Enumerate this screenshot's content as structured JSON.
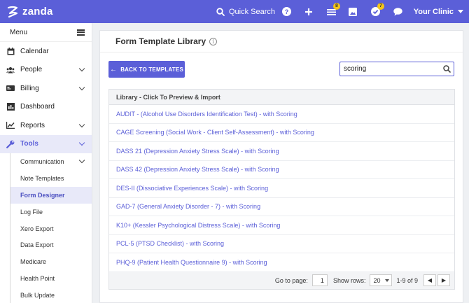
{
  "app": {
    "brand": "zanda",
    "accent": "#5b5fd8"
  },
  "topbar": {
    "quick_search": "Quick Search",
    "help_icon": "help-icon",
    "add_icon": "plus-icon",
    "tasks_badge": "8",
    "checks_badge": "7",
    "clinic_label": "Your Clinic"
  },
  "sidebar": {
    "menu_label": "Menu",
    "items": [
      {
        "label": "Calendar",
        "icon": "calendar-icon"
      },
      {
        "label": "People",
        "icon": "people-icon"
      },
      {
        "label": "Billing",
        "icon": "billing-icon"
      },
      {
        "label": "Dashboard",
        "icon": "dashboard-icon"
      },
      {
        "label": "Reports",
        "icon": "reports-icon"
      },
      {
        "label": "Tools",
        "icon": "wrench-icon"
      }
    ],
    "sub_items": [
      {
        "label": "Communication"
      },
      {
        "label": "Note Templates"
      },
      {
        "label": "Form Designer"
      },
      {
        "label": "Log File"
      },
      {
        "label": "Xero Export"
      },
      {
        "label": "Data Export"
      },
      {
        "label": "Medicare"
      },
      {
        "label": "Health Point"
      },
      {
        "label": "Bulk Update"
      }
    ]
  },
  "main": {
    "title": "Form Template Library",
    "back_button": "BACK TO TEMPLATES",
    "search_value": "scoring",
    "table_header": "Library - Click To Preview & Import",
    "rows": [
      "AUDIT - (Alcohol Use Disorders Identification Test) - with Scoring",
      "CAGE Screening (Social Work - Client Self-Assessment) - with Scoring",
      "DASS 21 (Depression Anxiety Stress Scale) - with Scoring",
      "DASS 42 (Depression Anxiety Stress Scale) - with Scoring",
      "DES-II (Dissociative Experiences Scale) - with Scoring",
      "GAD-7 (General Anxiety Disorder - 7) - with Scoring",
      "K10+ (Kessler Psychological Distress Scale) - with Scoring",
      "PCL-5 (PTSD Checklist) - with Scoring",
      "PHQ-9 (Patient Health Questionnaire 9) - with Scoring"
    ],
    "footer": {
      "goto_label": "Go to page:",
      "goto_value": "1",
      "rows_label": "Show rows:",
      "rows_value": "20",
      "range": "1-9 of 9"
    }
  }
}
